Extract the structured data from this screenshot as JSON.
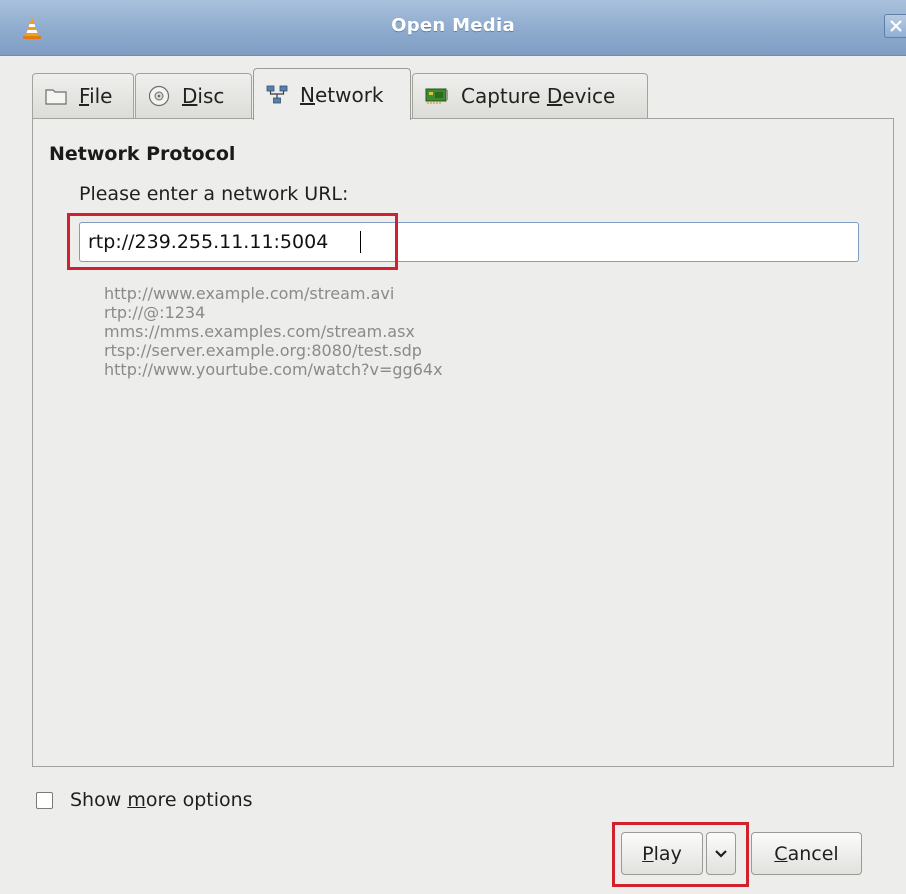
{
  "window": {
    "title": "Open Media",
    "colors": {
      "titlebar": "#8eabcd",
      "highlight": "#d1202e"
    }
  },
  "tabs": [
    {
      "key": "F",
      "rest": "ile",
      "icon": "folder-icon",
      "active": false
    },
    {
      "key": "D",
      "rest": "isc",
      "icon": "disc-icon",
      "active": false
    },
    {
      "key": "N",
      "rest": "etwork",
      "icon": "network-icon",
      "active": true
    },
    {
      "pre": "Capture ",
      "key": "D",
      "rest": "evice",
      "icon": "capture-card-icon",
      "active": false
    }
  ],
  "network": {
    "section_title": "Network Protocol",
    "prompt": "Please enter a network URL:",
    "url_value": "rtp://239.255.11.11:5004",
    "examples": [
      "http://www.example.com/stream.avi",
      "rtp://@:1234",
      "mms://mms.examples.com/stream.asx",
      "rtsp://server.example.org:8080/test.sdp",
      "http://www.yourtube.com/watch?v=gg64x"
    ]
  },
  "options": {
    "show_more_pre": "Show ",
    "show_more_key": "m",
    "show_more_rest": "ore options",
    "show_more_checked": false
  },
  "buttons": {
    "play_key": "P",
    "play_rest": "lay",
    "cancel_key": "C",
    "cancel_rest": "ancel"
  }
}
